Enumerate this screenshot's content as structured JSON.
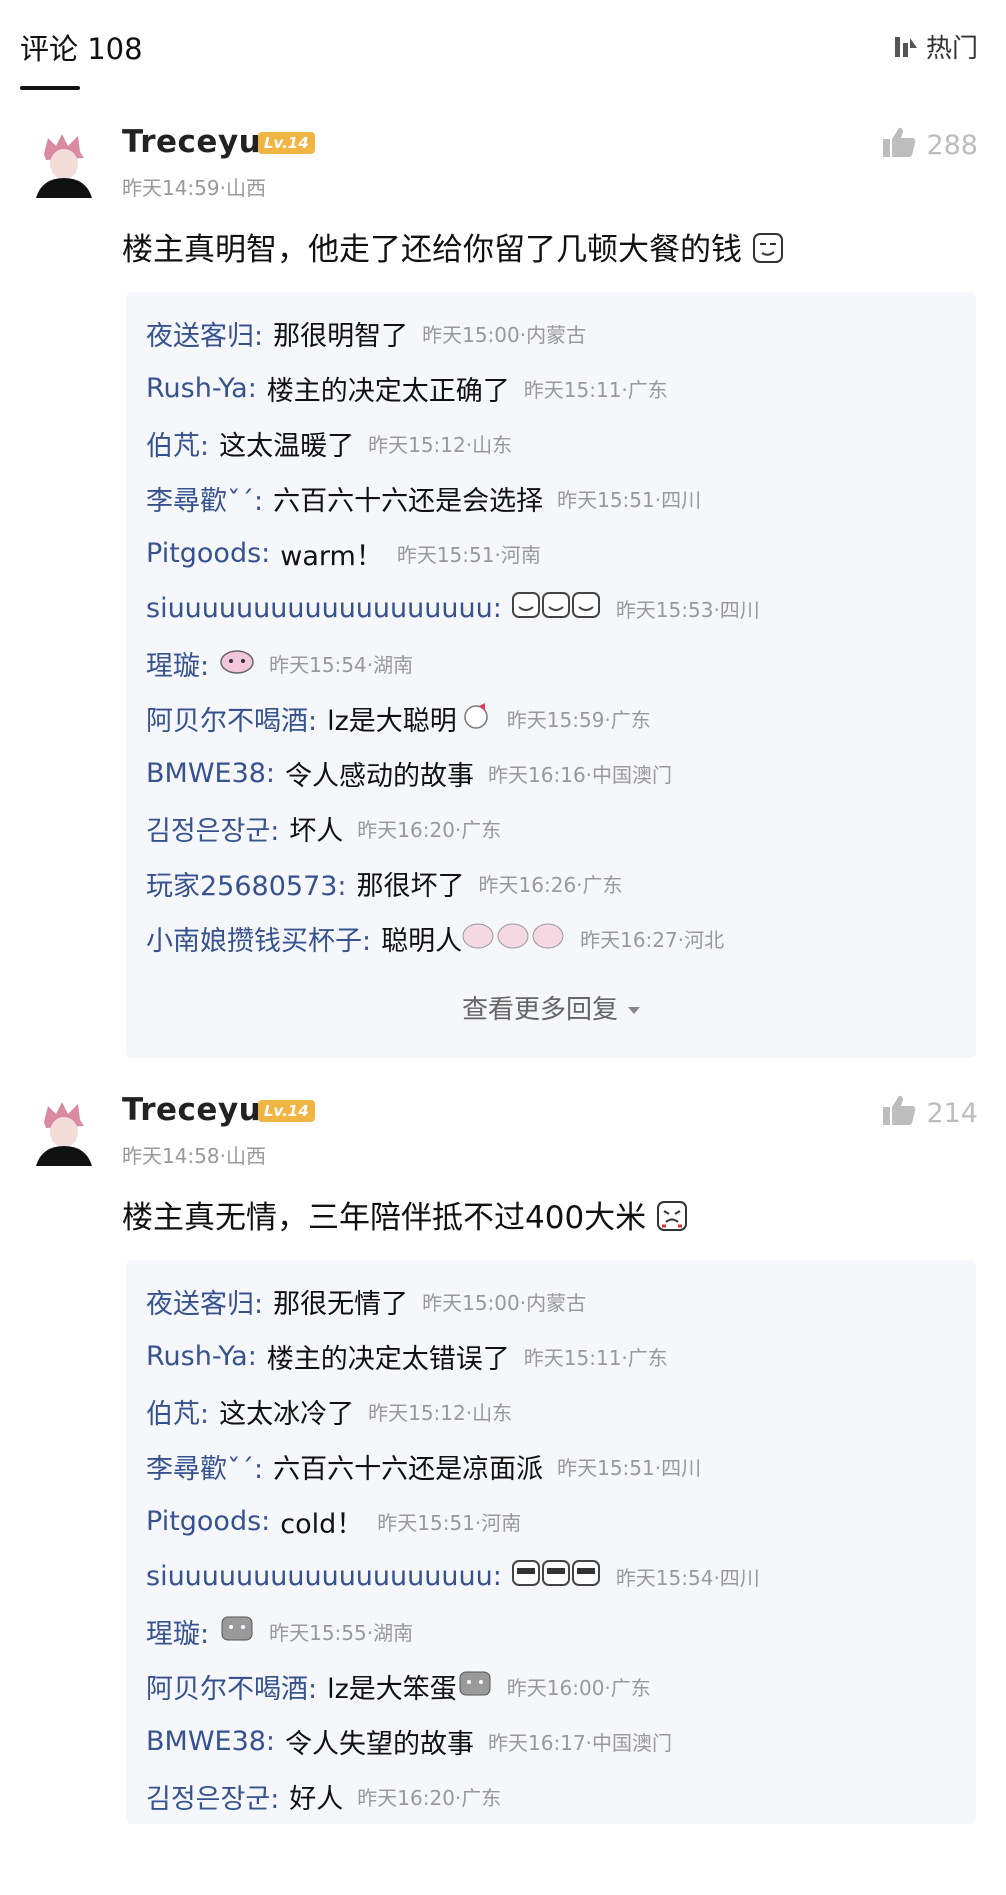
{
  "header": {
    "title": "评论 108",
    "sort_label": "热门"
  },
  "comments": [
    {
      "username": "Treceyu",
      "level": "Lv.14",
      "likes": "288",
      "meta": "昨天14:59·山西",
      "text": "楼主真明智，他走了还给你留了几顿大餐的钱",
      "replies": [
        {
          "name": "夜送客归:",
          "text": "那很明智了",
          "time": "昨天15:00·内蒙古"
        },
        {
          "name": "Rush-Ya:",
          "text": "楼主的决定太正确了",
          "time": "昨天15:11·广东"
        },
        {
          "name": "伯芃:",
          "text": "这太温暖了",
          "time": "昨天15:12·山东"
        },
        {
          "name": "李尋歡ˇˊ:",
          "text": "六百六十六还是会选择",
          "time": "昨天15:51·四川"
        },
        {
          "name": "Pitgoods:",
          "text": "warm！",
          "time": "昨天15:51·河南"
        },
        {
          "name": "siuuuuuuuuuuuuuuuuuuu:",
          "text": "",
          "time": "昨天15:53·四川"
        },
        {
          "name": "瑆璇:",
          "text": "",
          "time": "昨天15:54·湖南"
        },
        {
          "name": "阿贝尔不喝酒:",
          "text": "lz是大聪明",
          "time": "昨天15:59·广东"
        },
        {
          "name": "BMWE38:",
          "text": "令人感动的故事",
          "time": "昨天16:16·中国澳门"
        },
        {
          "name": "김정은장군:",
          "text": "坏人",
          "time": "昨天16:20·广东"
        },
        {
          "name": "玩家25680573:",
          "text": "那很坏了",
          "time": "昨天16:26·广东"
        },
        {
          "name": "小南娘攒钱买杯子:",
          "text": "聪明人",
          "time": "昨天16:27·河北"
        }
      ],
      "more_label": "查看更多回复"
    },
    {
      "username": "Treceyu",
      "level": "Lv.14",
      "likes": "214",
      "meta": "昨天14:58·山西",
      "text": "楼主真无情，三年陪伴抵不过400大米",
      "replies": [
        {
          "name": "夜送客归:",
          "text": "那很无情了",
          "time": "昨天15:00·内蒙古"
        },
        {
          "name": "Rush-Ya:",
          "text": "楼主的决定太错误了",
          "time": "昨天15:11·广东"
        },
        {
          "name": "伯芃:",
          "text": "这太冰冷了",
          "time": "昨天15:12·山东"
        },
        {
          "name": "李尋歡ˇˊ:",
          "text": "六百六十六还是凉面派",
          "time": "昨天15:51·四川"
        },
        {
          "name": "Pitgoods:",
          "text": "cold！",
          "time": "昨天15:51·河南"
        },
        {
          "name": "siuuuuuuuuuuuuuuuuuuu:",
          "text": "",
          "time": "昨天15:54·四川"
        },
        {
          "name": "瑆璇:",
          "text": "",
          "time": "昨天15:55·湖南"
        },
        {
          "name": "阿贝尔不喝酒:",
          "text": "lz是大笨蛋",
          "time": "昨天16:00·广东"
        },
        {
          "name": "BMWE38:",
          "text": "令人失望的故事",
          "time": "昨天16:17·中国澳门"
        },
        {
          "name": "김정은장군:",
          "text": "好人",
          "time": "昨天16:20·广东"
        }
      ]
    }
  ]
}
